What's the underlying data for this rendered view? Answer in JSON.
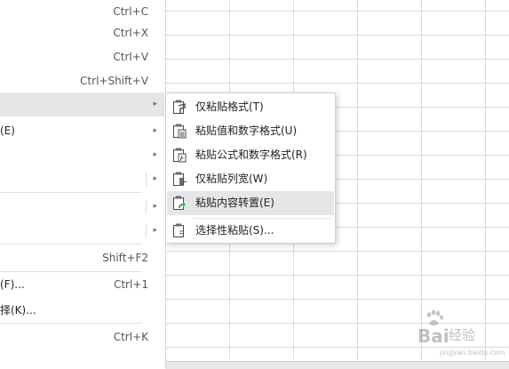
{
  "menu": {
    "items": [
      {
        "label": "",
        "shortcut": "Ctrl+C"
      },
      {
        "label": "",
        "shortcut": "Ctrl+X"
      },
      {
        "label": "",
        "shortcut": "Ctrl+V"
      },
      {
        "label": "",
        "shortcut": "Ctrl+Shift+V"
      },
      {
        "label": "(E)",
        "shortcut": ""
      },
      {
        "label": "",
        "shortcut": "Shift+F2"
      },
      {
        "label": "(F)...",
        "shortcut": "Ctrl+1"
      },
      {
        "label": "择(K)...",
        "shortcut": ""
      },
      {
        "label": "",
        "shortcut": "Ctrl+K"
      }
    ],
    "arrow": "▸"
  },
  "submenu": {
    "items": [
      {
        "label": "仅粘贴格式(T)",
        "icon": "paste-format-icon"
      },
      {
        "label": "粘贴值和数字格式(U)",
        "icon": "paste-values-number-icon"
      },
      {
        "label": "粘贴公式和数字格式(R)",
        "icon": "paste-formula-number-icon"
      },
      {
        "label": "仅粘贴列宽(W)",
        "icon": "paste-column-width-icon"
      },
      {
        "label": "粘贴内容转置(E)",
        "icon": "paste-transpose-icon"
      },
      {
        "label": "选择性粘贴(S)...",
        "icon": "paste-special-icon"
      }
    ]
  },
  "watermark": {
    "brand": "Bai",
    "suffix": "经验",
    "url": "jingyan.baidu.com"
  }
}
